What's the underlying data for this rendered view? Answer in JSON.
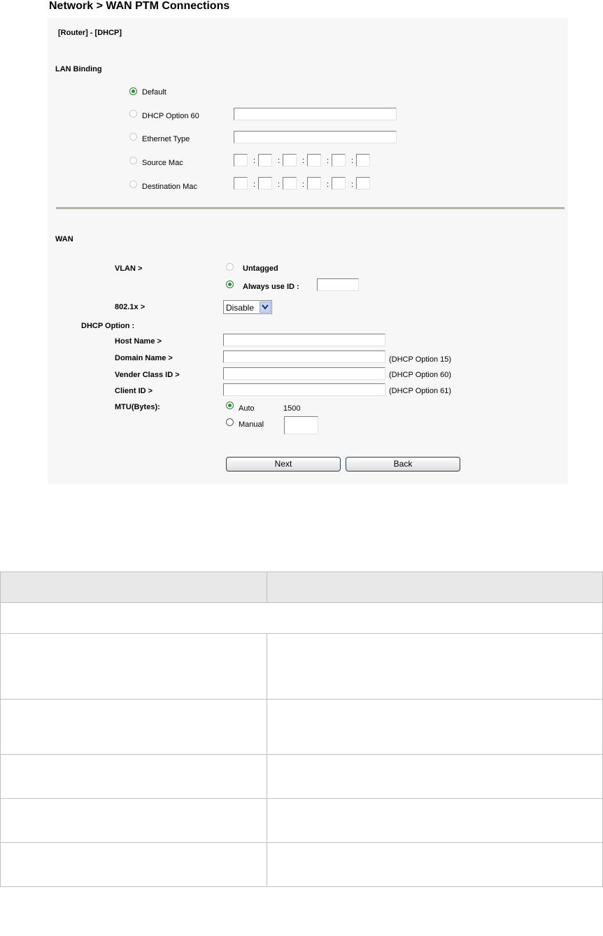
{
  "page": {
    "title": "Network > WAN PTM Connections"
  },
  "panel": {
    "mode": "[Router] - [DHCP]",
    "lan_binding": {
      "heading": "LAN Binding",
      "options": [
        {
          "label": "Default",
          "selected": true
        },
        {
          "label": "DHCP Option 60",
          "selected": false,
          "value": ""
        },
        {
          "label": "Ethernet Type",
          "selected": false,
          "value": ""
        },
        {
          "label": "Source Mac",
          "selected": false,
          "mac_separator": ":"
        },
        {
          "label": "Destination Mac",
          "selected": false,
          "mac_separator": ":"
        }
      ]
    },
    "wan": {
      "heading": "WAN",
      "vlan": {
        "label": "VLAN >",
        "untagged": "Untagged",
        "always": "Always use ID :",
        "id_value": "",
        "selected": "always"
      },
      "dot1x": {
        "label": "802.1x >",
        "value": "Disable"
      },
      "dhcp_option": {
        "heading": "DHCP Option :",
        "host_name": {
          "label": "Host Name >",
          "value": ""
        },
        "domain_name": {
          "label": "Domain Name >",
          "value": "",
          "note": "(DHCP Option 15)"
        },
        "vender_class": {
          "label": "Vender Class ID >",
          "value": "",
          "note": "(DHCP Option 60)"
        },
        "client_id": {
          "label": "Client ID >",
          "value": "",
          "note": "(DHCP Option 61)"
        }
      },
      "mtu": {
        "label": "MTU(Bytes):",
        "auto": "Auto",
        "auto_value": "1500",
        "manual": "Manual",
        "manual_value": "",
        "selected": "auto"
      }
    },
    "buttons": {
      "next": "Next",
      "back": "Back"
    }
  },
  "colors": {
    "panel_bg": "#f7f7f7",
    "radio_on": "#2e8b2e",
    "separator": "#b6b2a6",
    "table_header_bg": "#e8e8e8",
    "table_border": "#bfbfbf"
  }
}
